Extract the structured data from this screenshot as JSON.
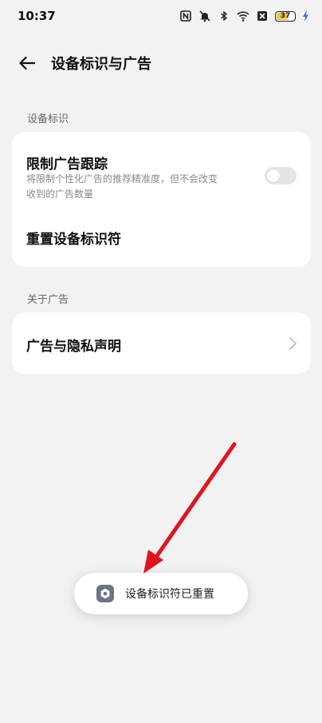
{
  "status_bar": {
    "time": "10:37",
    "icons": [
      "nfc-icon",
      "mute-icon",
      "bluetooth-icon",
      "wifi-icon",
      "no-sim-icon",
      "battery-icon",
      "charging-icon"
    ],
    "battery_level": "37",
    "battery_color": "#e6c84a"
  },
  "header": {
    "title": "设备标识与广告",
    "back_icon": "back-arrow-icon"
  },
  "sections": [
    {
      "label": "设备标识",
      "items": [
        {
          "title": "限制广告跟踪",
          "subtitle_line1": "将限制个性化广告的推荐精准度，但不会改变",
          "subtitle_line2": "收到的广告数量",
          "toggle_on": false
        },
        {
          "title": "重置设备标识符"
        }
      ]
    },
    {
      "label": "关于广告",
      "items": [
        {
          "title": "广告与隐私声明",
          "icon": "chevron-right-icon"
        }
      ]
    }
  ],
  "toast": {
    "text": "设备标识符已重置",
    "icon": "settings-gear-icon"
  },
  "annotation": {
    "type": "arrow",
    "color": "#e0141e"
  }
}
